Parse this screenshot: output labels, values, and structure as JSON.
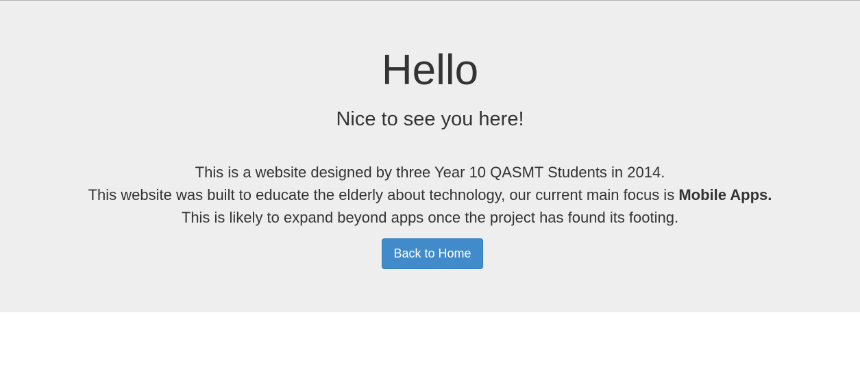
{
  "hero": {
    "title": "Hello",
    "subtitle": "Nice to see you here!",
    "description": {
      "line1": "This is a website designed by three Year 10 QASMT Students in 2014.",
      "line2_prefix": "This website was built to educate the elderly about technology, our current main focus is ",
      "line2_bold": "Mobile Apps.",
      "line3": "This is likely to expand beyond apps once the project has found its footing."
    },
    "button_label": "Back to Home"
  },
  "colors": {
    "jumbotron_bg": "#eeeeee",
    "text": "#333333",
    "button_bg": "#428bca",
    "button_text": "#ffffff"
  }
}
